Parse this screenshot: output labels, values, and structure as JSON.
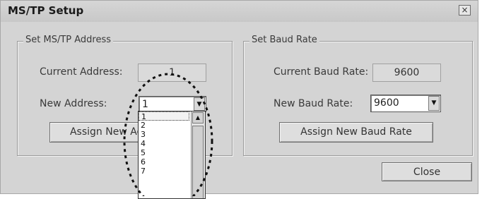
{
  "window": {
    "title": "MS/TP Setup",
    "close_glyph": "×"
  },
  "address_group": {
    "legend": "Set MS/TP Address",
    "current_label": "Current Address:",
    "current_value": "1",
    "new_label": "New Address:",
    "new_value": "1",
    "assign_label": "Assign New Address",
    "dropdown_options": [
      "1",
      "2",
      "3",
      "4",
      "5",
      "6",
      "7"
    ]
  },
  "baud_group": {
    "legend": "Set Baud Rate",
    "current_label": "Current Baud Rate:",
    "current_value": "9600",
    "new_label": "New Baud Rate:",
    "new_value": "9600",
    "assign_label": "Assign New Baud Rate"
  },
  "close_button": {
    "label": "Close"
  },
  "icons": {
    "dropdown_arrow": "chevron-down-icon",
    "scroll_up": "chevron-up-icon",
    "close": "close-icon"
  },
  "colors": {
    "callout": "#111111",
    "dialog_bg": "#d4d4d4"
  }
}
